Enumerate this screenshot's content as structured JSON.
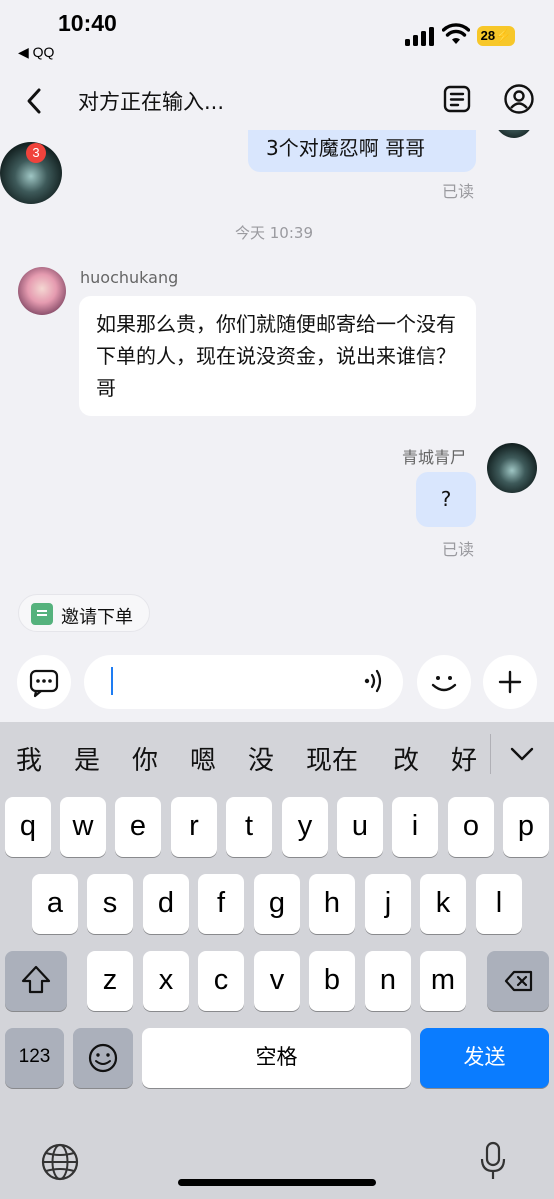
{
  "status_bar": {
    "time": "10:40",
    "back_app": "◀ QQ",
    "battery": "28"
  },
  "nav": {
    "title": "对方正在输入...",
    "back_icon": "chevron-left-icon",
    "menu_icon": "document-list-icon",
    "profile_icon": "person-circle-icon"
  },
  "chat": {
    "avatar_badge": "3",
    "messages": [
      {
        "side": "right",
        "text": "3个对魔忍啊 哥哥",
        "status": "已读"
      },
      {
        "type": "timestamp",
        "text": "今天 10:39"
      },
      {
        "side": "left",
        "sender": "huochukang",
        "text": "如果那么贵，你们就随便邮寄给一个没有下单的人，现在说没资金，说出来谁信？哥"
      },
      {
        "side": "right",
        "sender": "青城青尸",
        "text": "?",
        "status": "已读"
      }
    ]
  },
  "invite": {
    "label": "邀请下单"
  },
  "input": {
    "placeholder": ""
  },
  "keyboard": {
    "suggestions": [
      "我",
      "是",
      "你",
      "嗯",
      "没",
      "现在",
      "改",
      "好"
    ],
    "row1": [
      "q",
      "w",
      "e",
      "r",
      "t",
      "y",
      "u",
      "i",
      "o",
      "p"
    ],
    "row2": [
      "a",
      "s",
      "d",
      "f",
      "g",
      "h",
      "j",
      "k",
      "l"
    ],
    "row3": [
      "z",
      "x",
      "c",
      "v",
      "b",
      "n",
      "m"
    ],
    "numbers_label": "123",
    "space_label": "空格",
    "send_label": "发送"
  }
}
